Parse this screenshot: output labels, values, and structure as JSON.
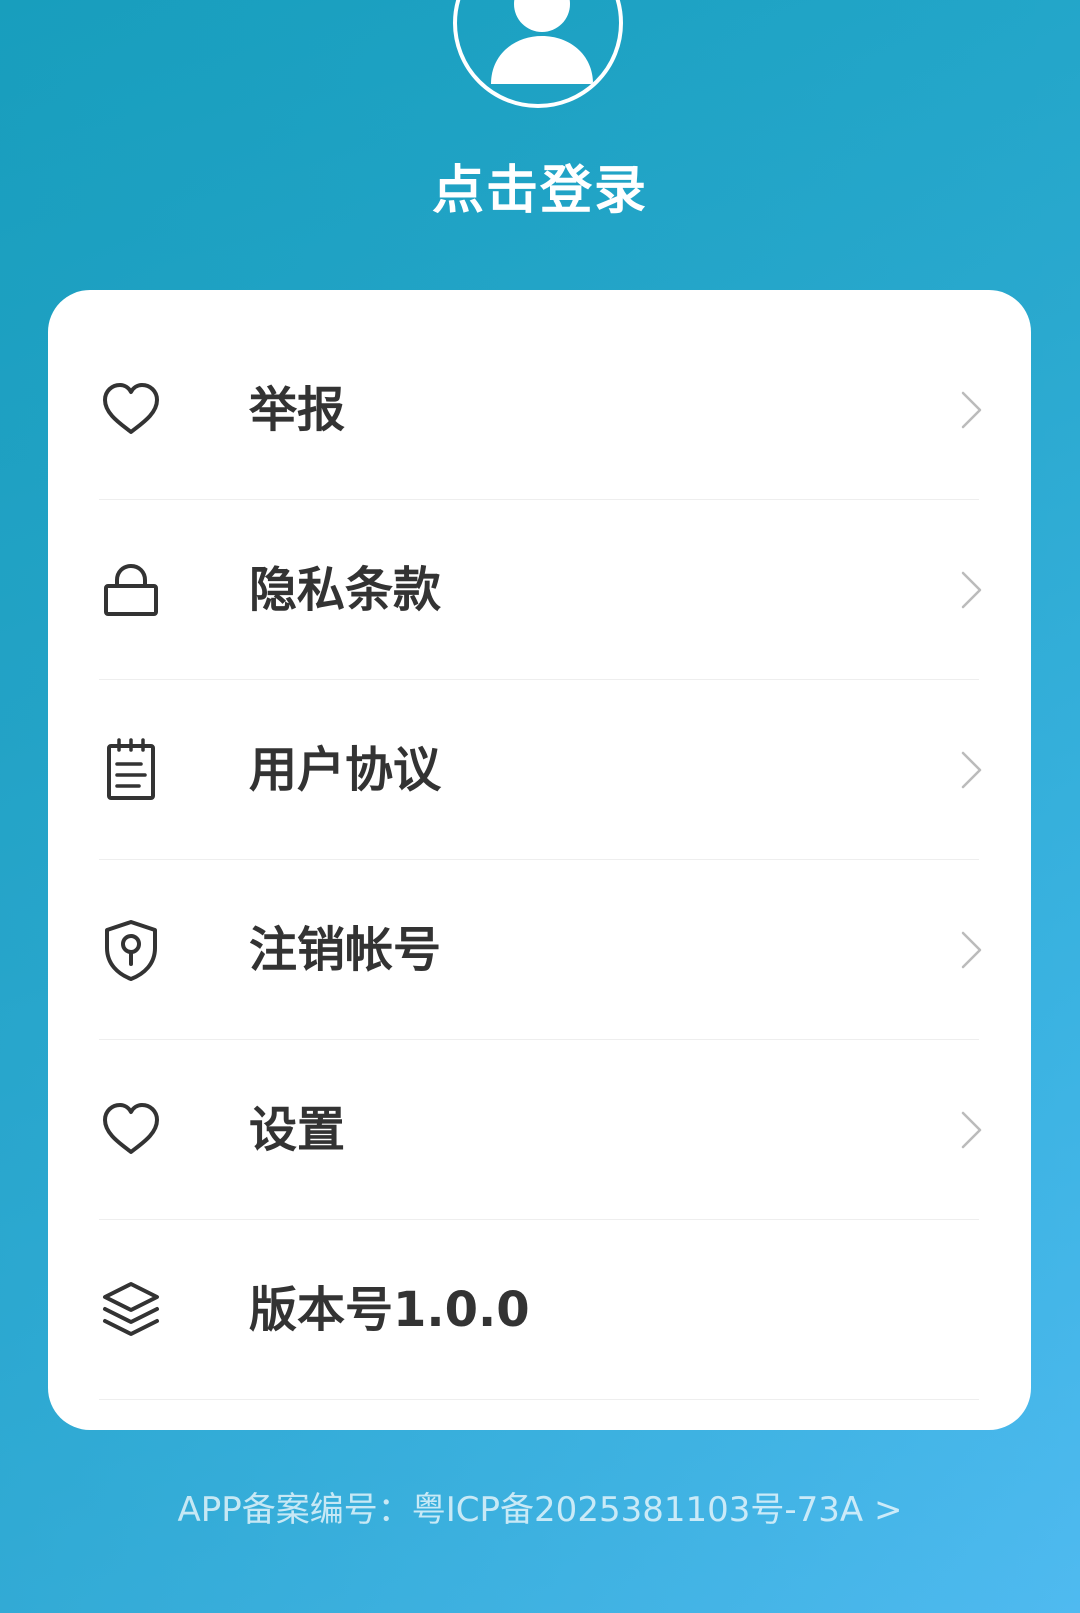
{
  "header": {
    "avatar_icon": "user-avatar-icon",
    "login_label": "点击登录"
  },
  "menu": {
    "items": [
      {
        "id": "report",
        "icon": "heart-icon",
        "label": "举报",
        "has_chevron": true
      },
      {
        "id": "privacy",
        "icon": "lock-icon",
        "label": "隐私条款",
        "has_chevron": true
      },
      {
        "id": "agreement",
        "icon": "notepad-icon",
        "label": "用户协议",
        "has_chevron": true
      },
      {
        "id": "delete-account",
        "icon": "shield-key-icon",
        "label": "注销帐号",
        "has_chevron": true
      },
      {
        "id": "settings",
        "icon": "heart-icon",
        "label": "设置",
        "has_chevron": true
      },
      {
        "id": "version",
        "icon": "layers-icon",
        "label": "版本号1.0.0",
        "has_chevron": false
      }
    ]
  },
  "footer": {
    "icp_text": "APP备案编号：粤ICP备2025381103号-73A >"
  },
  "colors": {
    "background_start": "#1aa2c2",
    "background_end": "#4fbaf0",
    "card": "#ffffff",
    "label": "#333333",
    "icon_stroke": "#333333",
    "chevron": "#bbbbbb",
    "divider": "#eeeeee"
  }
}
